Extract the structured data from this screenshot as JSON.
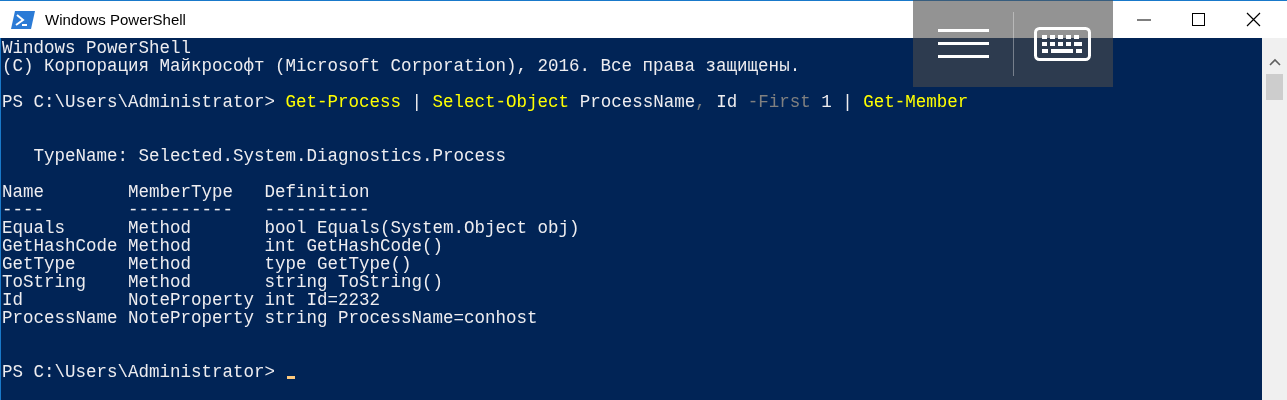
{
  "window": {
    "title": "Windows PowerShell"
  },
  "console": {
    "lines": [
      {
        "kind": "output",
        "text": "Windows PowerShell"
      },
      {
        "kind": "output",
        "text": "(C) Корпорация Майкрософт (Microsoft Corporation), 2016. Все права защищены."
      },
      {
        "kind": "blank"
      },
      {
        "kind": "command",
        "segments": [
          {
            "text": "PS C:\\Users\\Administrator>",
            "kind": "prompt"
          },
          {
            "text": "Get-Process",
            "kind": "cmdlet"
          },
          {
            "text": "|",
            "kind": "operator"
          },
          {
            "text": "Select-Object",
            "kind": "cmdlet"
          },
          {
            "text": "ProcessName",
            "kind": "argument"
          },
          {
            "text": ",",
            "kind": "separator"
          },
          {
            "text": "Id",
            "kind": "argument"
          },
          {
            "text": "-First",
            "kind": "parameter"
          },
          {
            "text": "1",
            "kind": "argument"
          },
          {
            "text": "|",
            "kind": "operator"
          },
          {
            "text": "Get-Member",
            "kind": "cmdlet"
          }
        ]
      },
      {
        "kind": "blank"
      },
      {
        "kind": "blank"
      },
      {
        "kind": "heading",
        "text": "TypeName: Selected.System.Diagnostics.Process"
      },
      {
        "kind": "blank"
      },
      {
        "kind": "table",
        "columns": [
          {
            "label": "Name",
            "rule": "----"
          },
          {
            "label": "MemberType",
            "rule": "----------"
          },
          {
            "label": "Definition",
            "rule": "----------"
          }
        ],
        "rows": [
          [
            "Equals",
            "Method",
            "bool Equals(System.Object obj)"
          ],
          [
            "GetHashCode",
            "Method",
            "int GetHashCode()"
          ],
          [
            "GetType",
            "Method",
            "type GetType()"
          ],
          [
            "ToString",
            "Method",
            "string ToString()"
          ],
          [
            "Id",
            "NoteProperty",
            "int Id=2232"
          ],
          [
            "ProcessName",
            "NoteProperty",
            "string ProcessName=conhost"
          ]
        ]
      },
      {
        "kind": "blank"
      },
      {
        "kind": "blank"
      },
      {
        "kind": "prompt",
        "prompt": "PS C:\\Users\\Administrator>",
        "cursor": true
      }
    ]
  }
}
